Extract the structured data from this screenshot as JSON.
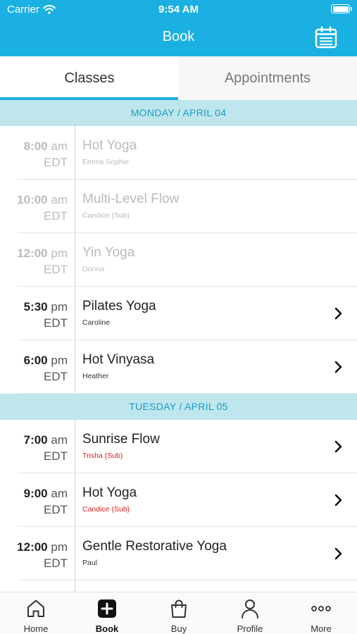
{
  "status_bar": {
    "carrier": "Carrier",
    "time": "9:54 AM"
  },
  "header": {
    "title": "Book"
  },
  "tabs": [
    {
      "label": "Classes",
      "active": true
    },
    {
      "label": "Appointments",
      "active": false
    }
  ],
  "days": [
    {
      "label": "MONDAY / APRIL 04",
      "classes": [
        {
          "hour": "8:00",
          "ampm": "am",
          "tz": "EDT",
          "name": "Hot Yoga",
          "instructor": "Emma Sophie",
          "past": true
        },
        {
          "hour": "10:00",
          "ampm": "am",
          "tz": "EDT",
          "name": "Multi-Level Flow",
          "instructor": "Candice (Sub)",
          "past": true
        },
        {
          "hour": "12:00",
          "ampm": "pm",
          "tz": "EDT",
          "name": "Yin Yoga",
          "instructor": "Donna",
          "past": true
        },
        {
          "hour": "5:30",
          "ampm": "pm",
          "tz": "EDT",
          "name": "Pilates Yoga",
          "instructor": "Caroline",
          "past": false
        },
        {
          "hour": "6:00",
          "ampm": "pm",
          "tz": "EDT",
          "name": "Hot Vinyasa",
          "instructor": "Heather",
          "past": false
        }
      ]
    },
    {
      "label": "TUESDAY / APRIL 05",
      "classes": [
        {
          "hour": "7:00",
          "ampm": "am",
          "tz": "EDT",
          "name": "Sunrise Flow",
          "instructor": "Trisha (Sub)",
          "past": false
        },
        {
          "hour": "9:00",
          "ampm": "am",
          "tz": "EDT",
          "name": "Hot Yoga",
          "instructor": "Candice (Sub)",
          "past": false
        },
        {
          "hour": "12:00",
          "ampm": "pm",
          "tz": "EDT",
          "name": "Gentle Restorative Yoga",
          "instructor": "Paul",
          "past": false
        }
      ]
    }
  ],
  "tab_bar": [
    {
      "label": "Home",
      "icon": "home-icon"
    },
    {
      "label": "Book",
      "icon": "plus-square-icon",
      "active": true
    },
    {
      "label": "Buy",
      "icon": "shopping-bag-icon"
    },
    {
      "label": "Profile",
      "icon": "person-icon"
    },
    {
      "label": "More",
      "icon": "more-dots-icon"
    }
  ],
  "colors": {
    "accent": "#1ab0e2",
    "day_header_bg": "#bee6ec",
    "day_header_text": "#1a9bc4",
    "sub_instructor": "#e02020",
    "past_text": "#bbbbbb"
  }
}
